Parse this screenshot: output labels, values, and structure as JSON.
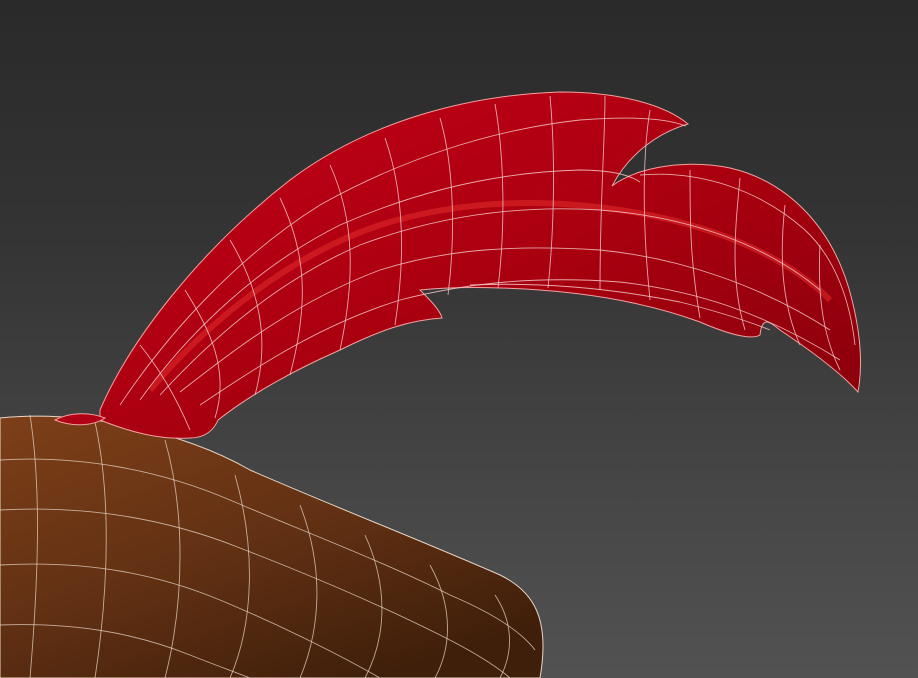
{
  "viewport": {
    "background_top_color": "#2a2a2a",
    "background_bottom_color": "#525252",
    "feather_color": "#b00012",
    "feather_highlight_color": "#e32b2b",
    "body_color": "#6a3515",
    "body_shadow_color": "#3f1f0a",
    "wireframe_color": "#f2c7c7"
  }
}
